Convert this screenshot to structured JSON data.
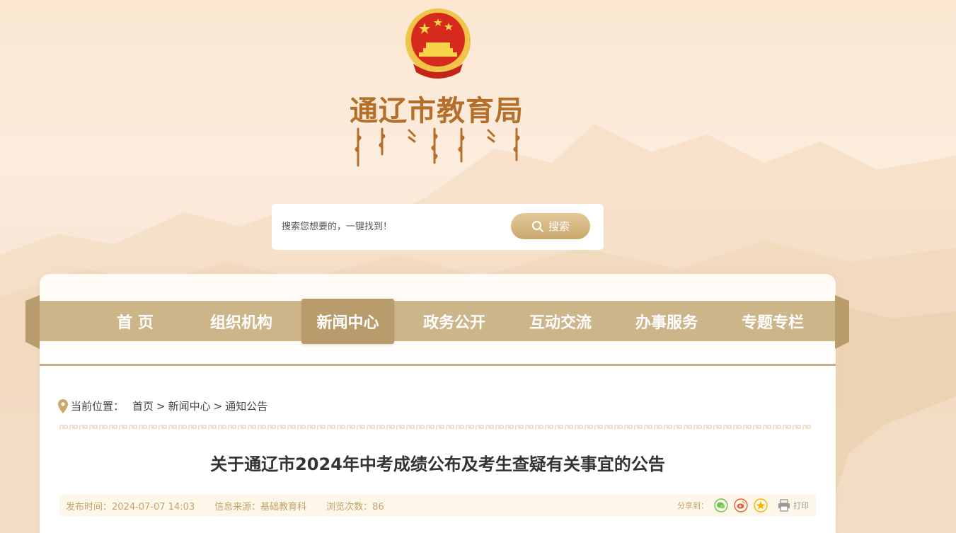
{
  "site": {
    "title": "通辽市教育局",
    "colors": {
      "title": "#b4702a",
      "nav": "#cdb58a",
      "nav_active": "#b89c6c",
      "meta_text": "#c4a26a"
    }
  },
  "search": {
    "placeholder": "搜索您想要的，一键找到！",
    "button_label": "搜索"
  },
  "nav": {
    "items": [
      {
        "label": "首 页"
      },
      {
        "label": "组织机构"
      },
      {
        "label": "新闻中心",
        "active": true
      },
      {
        "label": "政务公开"
      },
      {
        "label": "互动交流"
      },
      {
        "label": "办事服务"
      },
      {
        "label": "专题专栏"
      }
    ]
  },
  "breadcrumb": {
    "prefix": "当前位置：",
    "items": [
      "首页",
      ">",
      "新闻中心",
      ">",
      "通知公告"
    ]
  },
  "article": {
    "title": "关于通辽市2024年中考成绩公布及考生查疑有关事宜的公告",
    "publish_time": "发布时间：2024-07-07 14:03",
    "source": "信息来源：基础教育科",
    "views": "浏览次数：86",
    "share_label": "分享到：",
    "print_label": "打印"
  },
  "icons": [
    "location-pin-icon",
    "search-icon",
    "wechat-icon",
    "weibo-icon",
    "qzone-icon",
    "printer-icon",
    "national-emblem-icon"
  ]
}
